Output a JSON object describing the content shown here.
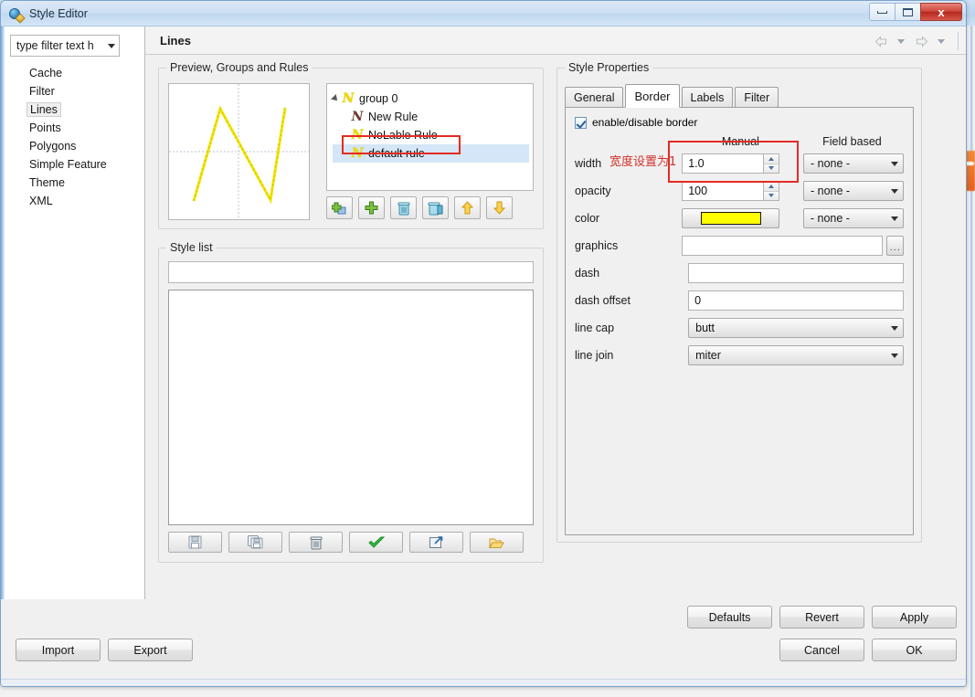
{
  "window": {
    "title": "Style Editor",
    "icon": "globe-pencil-icon",
    "minimize_label": "",
    "maximize_label": "",
    "close_label": "x"
  },
  "sidebar": {
    "filter": {
      "value": "type filter text h",
      "placeholder": "type filter text here"
    },
    "items": [
      {
        "label": "Cache",
        "selected": false
      },
      {
        "label": "Filter",
        "selected": false
      },
      {
        "label": "Lines",
        "selected": true
      },
      {
        "label": "Points",
        "selected": false
      },
      {
        "label": "Polygons",
        "selected": false
      },
      {
        "label": "Simple Feature",
        "selected": false
      },
      {
        "label": "Theme",
        "selected": false
      },
      {
        "label": "XML",
        "selected": false
      }
    ]
  },
  "header": {
    "title": "Lines",
    "back_icon": "back-arrow-icon",
    "back_menu_icon": "chevron-down-icon",
    "forward_icon": "forward-arrow-icon",
    "forward_menu_icon": "chevron-down-icon"
  },
  "preview_groups": {
    "legend": "Preview, Groups and Rules",
    "preview": {
      "line_color": "#f2e500",
      "grid_color": "#b9c4d6"
    },
    "tree": [
      {
        "label": "group 0",
        "icon": "rule-n-yellow-icon",
        "level": 0,
        "expanded": true,
        "selected": false
      },
      {
        "label": "New Rule",
        "icon": "rule-n-dark-icon",
        "level": 1,
        "selected": false
      },
      {
        "label": "NoLable Rule",
        "icon": "rule-n-yellow-icon",
        "level": 1,
        "selected": false
      },
      {
        "label": "default rule",
        "icon": "rule-n-yellow-icon",
        "level": 1,
        "selected": true,
        "highlighted": true
      }
    ],
    "toolbar": [
      {
        "name": "add-group-button",
        "icon": "add-group-icon"
      },
      {
        "name": "add-rule-button",
        "icon": "plus-icon"
      },
      {
        "name": "delete-rule-button",
        "icon": "trash-icon"
      },
      {
        "name": "delete-all-button",
        "icon": "trash-all-icon"
      },
      {
        "name": "move-up-button",
        "icon": "arrow-up-icon"
      },
      {
        "name": "move-down-button",
        "icon": "arrow-down-icon"
      }
    ]
  },
  "style_list": {
    "legend": "Style list",
    "name_value": "",
    "items": [],
    "toolbar": [
      {
        "name": "save-style-button",
        "icon": "floppy-disk-icon"
      },
      {
        "name": "save-as-style-button",
        "icon": "copy-floppy-icon"
      },
      {
        "name": "delete-style-button",
        "icon": "trash-icon"
      },
      {
        "name": "apply-style-button",
        "icon": "green-check-icon"
      },
      {
        "name": "export-style-button",
        "icon": "export-arrow-icon"
      },
      {
        "name": "open-style-button",
        "icon": "open-folder-icon"
      }
    ]
  },
  "style_properties": {
    "legend": "Style Properties",
    "tabs": [
      {
        "label": "General",
        "active": false
      },
      {
        "label": "Border",
        "active": true
      },
      {
        "label": "Labels",
        "active": false
      },
      {
        "label": "Filter",
        "active": false
      }
    ],
    "enable_border": {
      "label": "enable/disable border",
      "checked": true
    },
    "column_headers": {
      "manual": "Manual",
      "field_based": "Field based"
    },
    "annotation": {
      "text": "宽度设置为1",
      "color": "#d0322a",
      "box_color": "#e32b23"
    },
    "rows": [
      {
        "label": "width",
        "manual_type": "spinner",
        "manual_value": "1.0",
        "field_value": "- none -"
      },
      {
        "label": "opacity",
        "manual_type": "spinner",
        "manual_value": "100",
        "field_value": "- none -"
      },
      {
        "label": "color",
        "manual_type": "color",
        "manual_value": "#ffff00",
        "field_value": "- none -"
      },
      {
        "label": "graphics",
        "manual_type": "text-browse",
        "manual_value": "",
        "browse_label": "..."
      },
      {
        "label": "dash",
        "manual_type": "text",
        "manual_value": ""
      },
      {
        "label": "dash offset",
        "manual_type": "text",
        "manual_value": "0"
      },
      {
        "label": "line cap",
        "manual_type": "combo",
        "manual_value": "butt"
      },
      {
        "label": "line join",
        "manual_type": "combo",
        "manual_value": "miter"
      }
    ]
  },
  "footer": {
    "defaults": "Defaults",
    "revert": "Revert",
    "apply": "Apply",
    "import": "Import",
    "export": "Export",
    "cancel": "Cancel",
    "ok": "OK"
  }
}
